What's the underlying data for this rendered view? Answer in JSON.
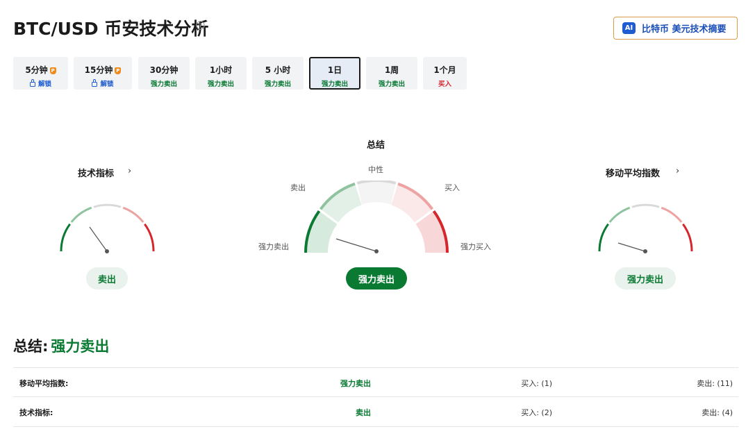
{
  "header": {
    "title": "BTC/USD 币安技术分析",
    "ai_button_badge": "AI",
    "ai_button_label": "比特币 美元技术摘要"
  },
  "tabs": [
    {
      "label": "5分钟",
      "status": "解锁",
      "locked": true
    },
    {
      "label": "15分钟",
      "status": "解锁",
      "locked": true
    },
    {
      "label": "30分钟",
      "status": "强力卖出"
    },
    {
      "label": "1小时",
      "status": "强力卖出"
    },
    {
      "label": "5 小时",
      "status": "强力卖出"
    },
    {
      "label": "1日",
      "status": "强力卖出",
      "active": true
    },
    {
      "label": "1周",
      "status": "强力卖出"
    },
    {
      "label": "1个月",
      "status": "买入"
    }
  ],
  "gauges": {
    "left": {
      "title": "技术指标",
      "result": "卖出"
    },
    "center": {
      "title": "总结",
      "labels": {
        "neutral": "中性",
        "sell": "卖出",
        "buy": "买入",
        "strong_sell": "强力卖出",
        "strong_buy": "强力买入"
      },
      "result": "强力卖出"
    },
    "right": {
      "title": "移动平均指数",
      "result": "强力卖出"
    }
  },
  "summary": {
    "label": "总结:",
    "value": "强力卖出"
  },
  "table": [
    {
      "name": "移动平均指数:",
      "value": "强力卖出",
      "buy": "买入: (1)",
      "sell": "卖出: (11)"
    },
    {
      "name": "技术指标:",
      "value": "卖出",
      "buy": "买入: (2)",
      "sell": "卖出: (4)"
    }
  ],
  "colors": {
    "strong_sell": "#0a7a33",
    "sell": "#8fc3a0",
    "neutral": "#d9d9d9",
    "buy": "#eea3a3",
    "strong_buy": "#d6262b",
    "accent": "#1f5bd1"
  }
}
